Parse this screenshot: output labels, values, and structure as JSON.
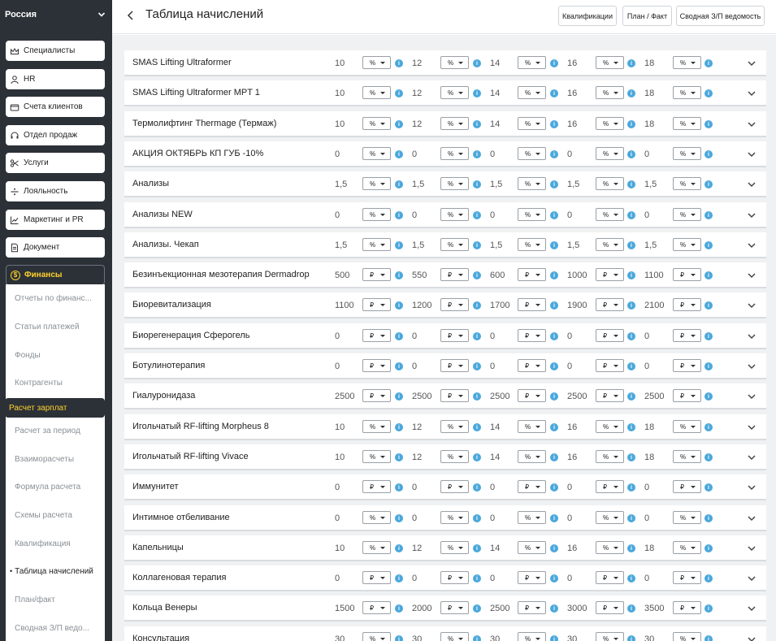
{
  "sidebar": {
    "region": "Россия",
    "nav": [
      {
        "label": "Специалисты",
        "icon": "crown-icon"
      },
      {
        "label": "HR",
        "icon": "user-icon"
      },
      {
        "label": "Счета клиентов",
        "icon": "wallet-icon"
      },
      {
        "label": "Отдел продаж",
        "icon": "headset-icon"
      },
      {
        "label": "Услуги",
        "icon": "scissors-icon"
      },
      {
        "label": "Лояльность",
        "icon": "percent-icon"
      },
      {
        "label": "Маркетинг и PR",
        "icon": "chart-icon"
      },
      {
        "label": "Документ",
        "icon": "document-icon"
      }
    ],
    "finance_label": "Финансы",
    "finance_icon_glyph": "$",
    "submenu": [
      "Отчеты по финанс...",
      "Статьи платежей",
      "Фонды",
      "Контрагенты",
      "Расчет зарплат",
      "Расчет за период",
      "Взаиморасчеты",
      "Формула расчета",
      "Схемы расчета",
      "Квалификация",
      "Таблица начислений",
      "План/факт",
      "Сводная З/П ведо..."
    ],
    "submenu_highlight_index": 4,
    "submenu_current_index": 10
  },
  "header": {
    "title": "Таблица начислений",
    "buttons": [
      "Квалификации",
      "План / Факт",
      "Сводная З/П ведомость"
    ]
  },
  "colors": {
    "sidebar_bg": "#2b3137",
    "accent": "#ffd12b",
    "info": "#4aa8dc"
  },
  "info_glyph": "i",
  "rows": [
    {
      "name": "SMAS Lifting Ultraformer",
      "values": [
        "10",
        "12",
        "14",
        "16",
        "18"
      ],
      "unit": "%"
    },
    {
      "name": "SMAS Lifting Ultraformer MPT 1",
      "values": [
        "10",
        "12",
        "14",
        "16",
        "18"
      ],
      "unit": "%"
    },
    {
      "name": "Термолифтинг Thermage (Термаж)",
      "values": [
        "10",
        "12",
        "14",
        "16",
        "18"
      ],
      "unit": "%"
    },
    {
      "name": "АКЦИЯ ОКТЯБРЬ КП ГУБ -10%",
      "values": [
        "0",
        "0",
        "0",
        "0",
        "0"
      ],
      "unit": "%"
    },
    {
      "name": "Анализы",
      "values": [
        "1,5",
        "1,5",
        "1,5",
        "1,5",
        "1,5"
      ],
      "unit": "%"
    },
    {
      "name": "Анализы NEW",
      "values": [
        "0",
        "0",
        "0",
        "0",
        "0"
      ],
      "unit": "%"
    },
    {
      "name": "Анализы. Чекап",
      "values": [
        "1,5",
        "1,5",
        "1,5",
        "1,5",
        "1,5"
      ],
      "unit": "%"
    },
    {
      "name": "Безинъекционная мезотерапия Dermadrop",
      "values": [
        "500",
        "550",
        "600",
        "1000",
        "1100"
      ],
      "unit": "₽"
    },
    {
      "name": "Биоревитализация",
      "values": [
        "1100",
        "1200",
        "1700",
        "1900",
        "2100"
      ],
      "unit": "₽"
    },
    {
      "name": "Биорегенерация Сферогель",
      "values": [
        "0",
        "0",
        "0",
        "0",
        "0"
      ],
      "unit": "₽"
    },
    {
      "name": "Ботулинотерапия",
      "values": [
        "0",
        "0",
        "0",
        "0",
        "0"
      ],
      "unit": "₽"
    },
    {
      "name": "Гиалуронидаза",
      "values": [
        "2500",
        "2500",
        "2500",
        "2500",
        "2500"
      ],
      "unit": "₽"
    },
    {
      "name": "Игольчатый RF-lifting Morpheus 8",
      "values": [
        "10",
        "12",
        "14",
        "16",
        "18"
      ],
      "unit": "%"
    },
    {
      "name": "Игольчатый RF-lifting Vivace",
      "values": [
        "10",
        "12",
        "14",
        "16",
        "18"
      ],
      "unit": "%"
    },
    {
      "name": "Иммунитет",
      "values": [
        "0",
        "0",
        "0",
        "0",
        "0"
      ],
      "unit": "₽"
    },
    {
      "name": "Интимное отбеливание",
      "values": [
        "0",
        "0",
        "0",
        "0",
        "0"
      ],
      "unit": "%"
    },
    {
      "name": "Капельницы",
      "values": [
        "10",
        "12",
        "14",
        "16",
        "18"
      ],
      "unit": "%"
    },
    {
      "name": "Коллагеновая терапия",
      "values": [
        "0",
        "0",
        "0",
        "0",
        "0"
      ],
      "unit": "₽"
    },
    {
      "name": "Кольца Венеры",
      "values": [
        "1500",
        "2000",
        "2500",
        "3000",
        "3500"
      ],
      "unit": "₽"
    },
    {
      "name": "Консультация",
      "values": [
        "30",
        "30",
        "30",
        "30",
        "30"
      ],
      "unit": "%"
    }
  ]
}
